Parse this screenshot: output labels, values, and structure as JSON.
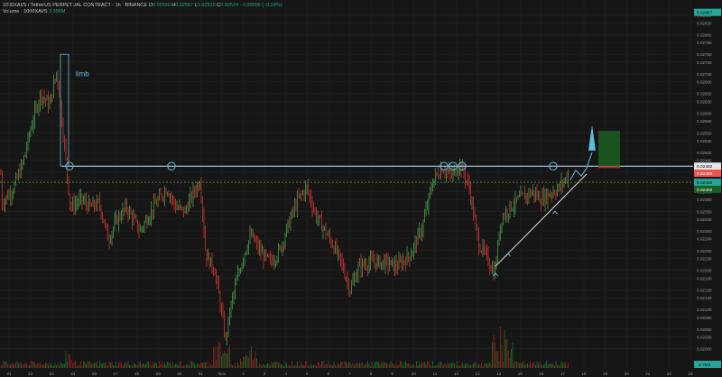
{
  "header": {
    "symbol": "1000XAI/S / TetherUS PERPETUAL CONTRACT · 1h · BINANCE",
    "o_label": "O",
    "o_value": "0.02530",
    "h_label": "H",
    "h_value": "0.02557",
    "l_label": "L",
    "l_value": "0.02510",
    "c_label": "C",
    "c_value": "0.02524",
    "change": "−0.00006 (−0.24%)"
  },
  "oscillator": {
    "label": "Volume · 1000XAI/S",
    "value": "3.396M"
  },
  "annotations": {
    "drawn_label": "limb"
  },
  "price_badges": [
    {
      "text": "0.02857",
      "bg": "#26a69a",
      "fg": "#0b0b0b",
      "price": 0.02857
    },
    {
      "text": "0.02482",
      "bg": "#e6e6e6",
      "fg": "#111111",
      "price": 0.02465
    },
    {
      "text": "0.02490",
      "bg": "#ef5350",
      "fg": "#ffffff",
      "price": 0.02447
    },
    {
      "text": "0.02420",
      "bg": "#26a69a",
      "fg": "#0b0b0b",
      "price": 0.02424
    },
    {
      "text": "0.02402",
      "bg": "#1b5e20",
      "fg": "#ffffff",
      "price": 0.02406
    }
  ],
  "volume_badge": {
    "text": "2.75M",
    "bg": "#26a69a",
    "fg": "#0b0b0b"
  },
  "colors": {
    "up": "#26a69a",
    "down": "#ef5350",
    "bull_candle": "#4caf50",
    "bear_candle": "#e53935",
    "resistance": "#cfe3ff",
    "circle": "#5bc0de",
    "target_box": "#1b5e20",
    "dashed_line": "#7cb342"
  },
  "chart_data": {
    "type": "candlestick",
    "price_axis": {
      "ticks": [
        "0.02850",
        "0.02830",
        "0.02800",
        "0.02780",
        "0.02750",
        "0.02730",
        "0.02700",
        "0.02680",
        "0.02650",
        "0.02630",
        "0.02600",
        "0.02580",
        "0.02550",
        "0.02530",
        "0.02500",
        "0.02480",
        "0.02450",
        "0.02430",
        "0.02400",
        "0.02380",
        "0.02350",
        "0.02330",
        "0.02300",
        "0.02280",
        "0.02250",
        "0.02230",
        "0.02200",
        "0.02180",
        "0.02150",
        "0.02130",
        "0.02100",
        "0.02080",
        "0.02050",
        "0.02030",
        "0.02000"
      ],
      "range": [
        0.0196,
        0.0287
      ]
    },
    "time_axis": {
      "ticks": [
        "21",
        "22",
        "23",
        "24",
        "26",
        "27",
        "28",
        "29",
        "30",
        "31",
        "Nov",
        "2",
        "3",
        "4",
        "5",
        "6",
        "7",
        "8",
        "9",
        "10",
        "11",
        "12",
        "13",
        "14",
        "15",
        "16",
        "17",
        "18",
        "19",
        "20",
        "21",
        "22",
        "23"
      ]
    },
    "resistance_level": 0.02465,
    "close_price": 0.02424
  }
}
